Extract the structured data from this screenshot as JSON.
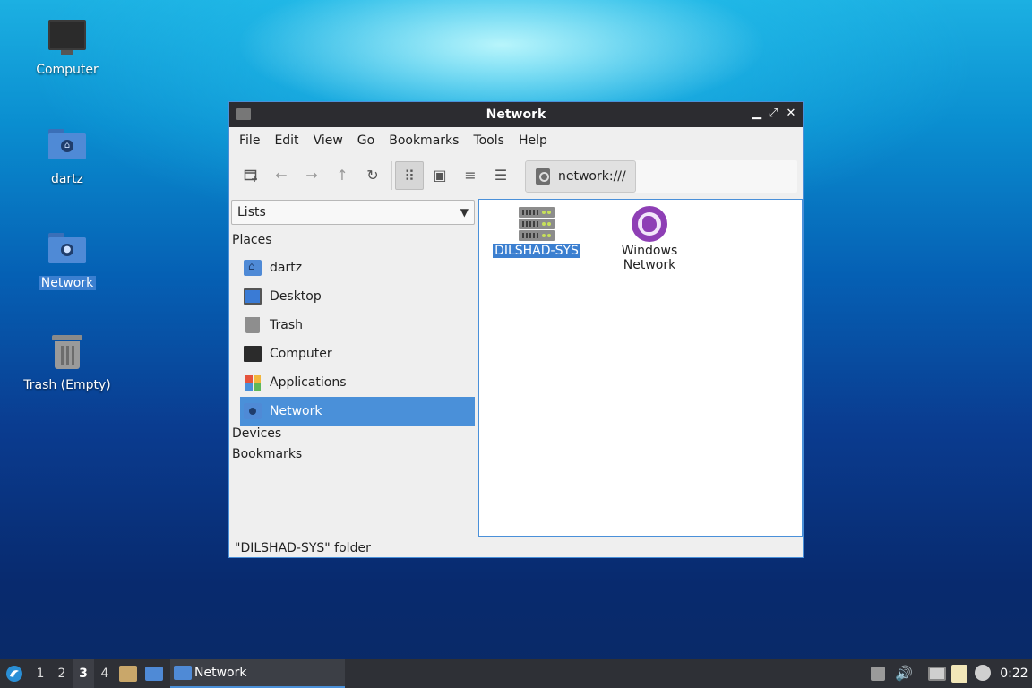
{
  "desktop": {
    "icons": [
      {
        "label": "Computer"
      },
      {
        "label": "dartz"
      },
      {
        "label": "Network"
      },
      {
        "label": "Trash (Empty)"
      }
    ]
  },
  "window": {
    "title": "Network",
    "controls": {
      "minimize": "▁",
      "maximize": "⤢",
      "close": "✕"
    }
  },
  "menubar": [
    "File",
    "Edit",
    "View",
    "Go",
    "Bookmarks",
    "Tools",
    "Help"
  ],
  "toolbar": {
    "new_tab_icon": "new-tab-icon",
    "back_icon": "←",
    "forward_icon": "→",
    "up_icon": "↑",
    "reload_icon": "↻",
    "view_icons": "⠿",
    "view_thumbnails": "▣",
    "view_compact": "≡",
    "view_details": "☰",
    "location": "network:///"
  },
  "sidepane": {
    "mode": "Lists",
    "sections": {
      "places": "Places",
      "devices": "Devices",
      "bookmarks": "Bookmarks"
    },
    "places": [
      {
        "label": "dartz"
      },
      {
        "label": "Desktop"
      },
      {
        "label": "Trash"
      },
      {
        "label": "Computer"
      },
      {
        "label": "Applications"
      },
      {
        "label": "Network"
      }
    ],
    "selected": "Network"
  },
  "files": [
    {
      "label": "DILSHAD-SYS",
      "icon": "server-icon",
      "selected": true
    },
    {
      "label_line1": "Windows",
      "label_line2": "Network",
      "icon": "windows-network-icon"
    }
  ],
  "statusbar": "\"DILSHAD-SYS\" folder",
  "taskbar": {
    "workspaces": [
      "1",
      "2",
      "3",
      "4"
    ],
    "active_workspace": "3",
    "task_label": "Network",
    "clock": "0:22"
  },
  "colors": {
    "accent": "#4a90d9",
    "titlebar": "#2c2c30",
    "taskbar": "#2e3036"
  }
}
